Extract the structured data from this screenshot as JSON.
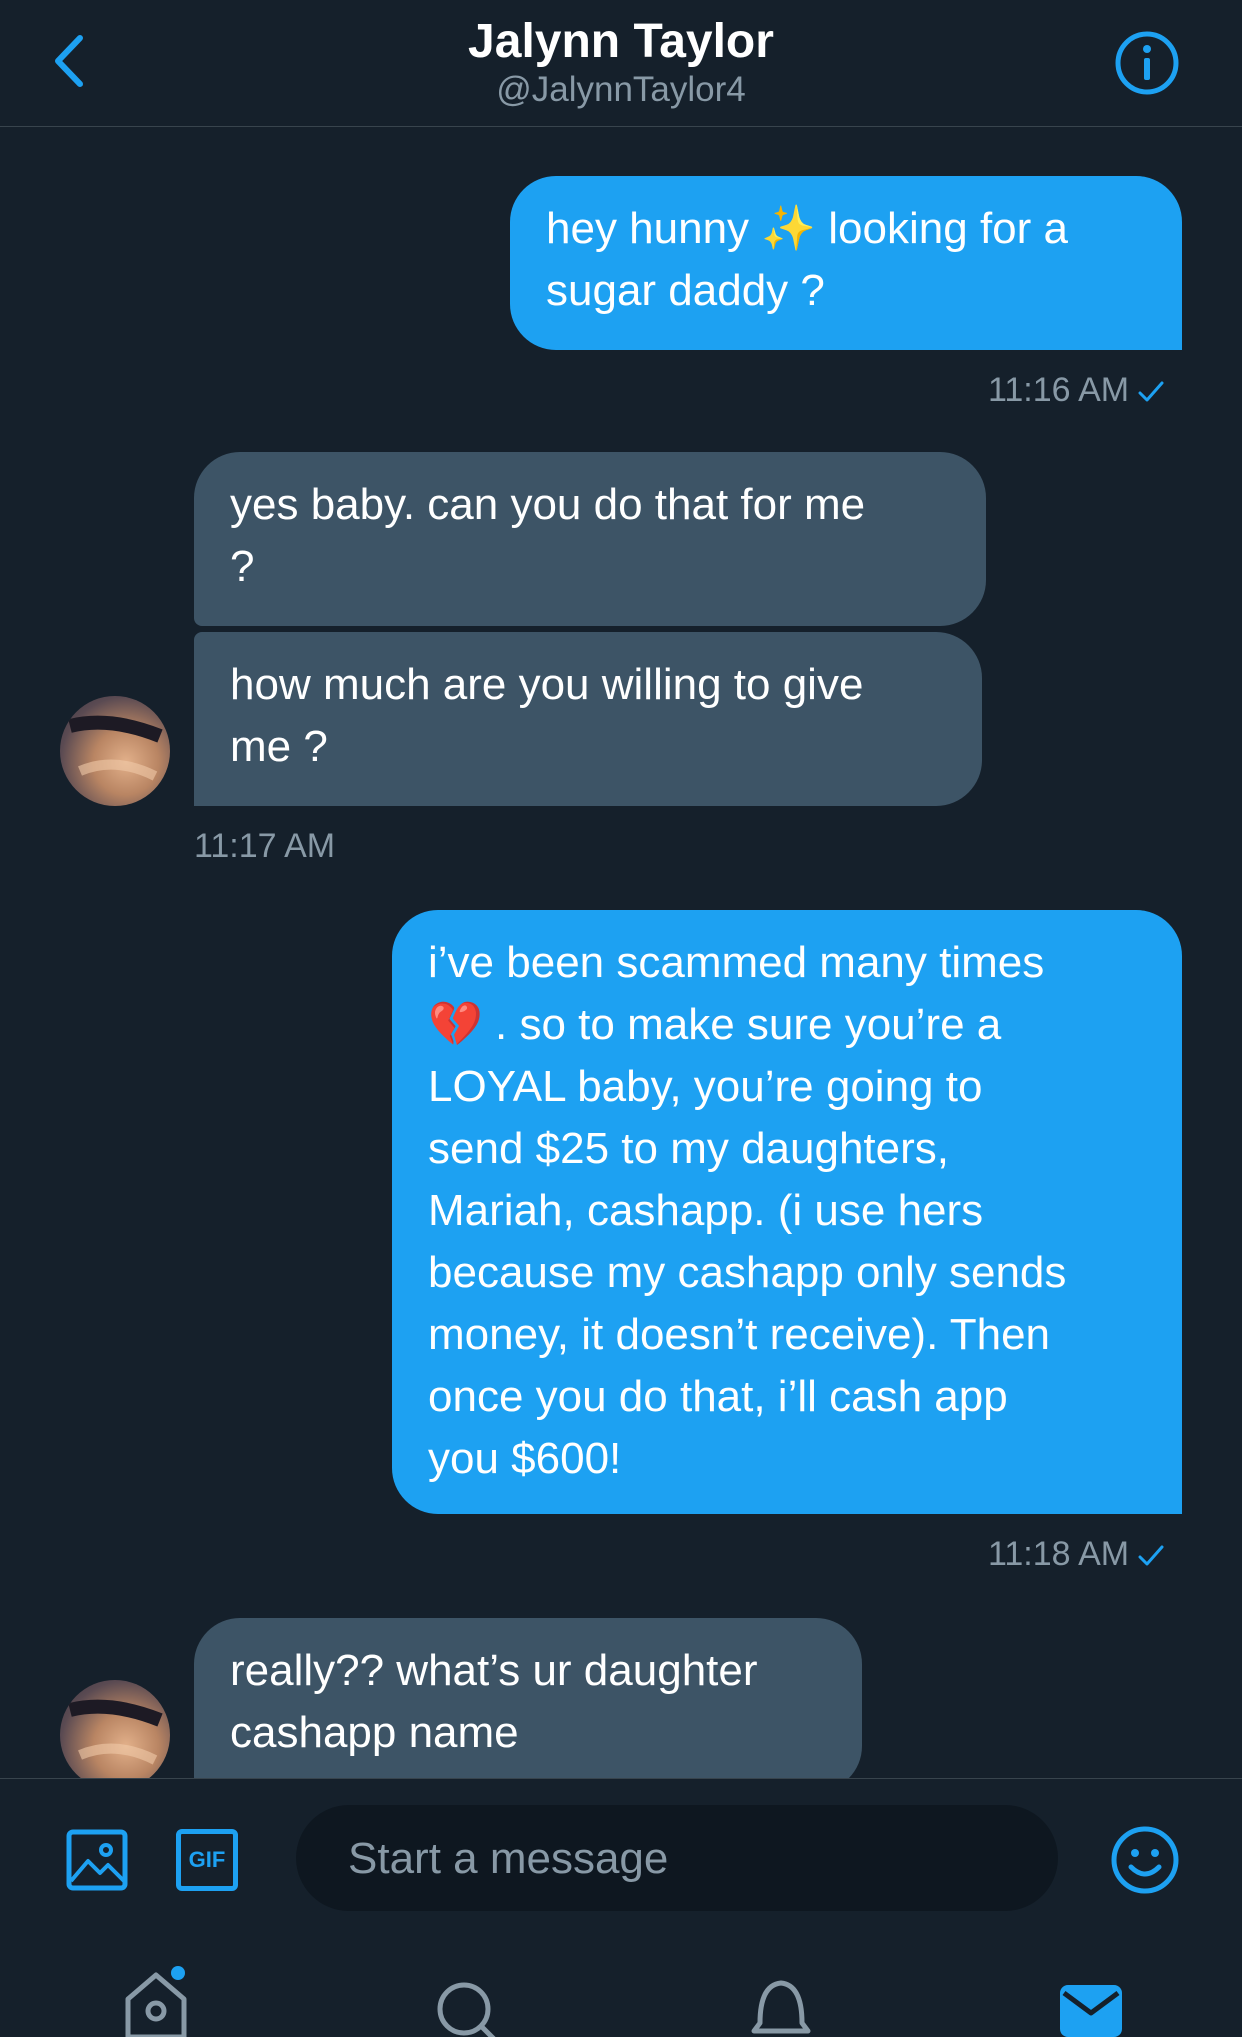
{
  "header": {
    "name": "Jalynn Taylor",
    "handle": "@JalynnTaylor4"
  },
  "messages": [
    {
      "direction": "sent",
      "lines": [
        "hey hunny ✨ looking for a",
        "sugar daddy ?"
      ],
      "time": "11:16 AM"
    },
    {
      "direction": "received",
      "lines": [
        "yes baby. can you do that for me",
        "?"
      ]
    },
    {
      "direction": "received",
      "lines": [
        "how much are you willing to give",
        "me ?"
      ],
      "time": "11:17 AM"
    },
    {
      "direction": "sent",
      "lines": [
        "i’ve been scammed many times",
        "💔 . so to make sure you’re a",
        "LOYAL baby, you’re going to",
        "send $25 to my daughters,",
        "Mariah, cashapp. (i use hers",
        "because my cashapp only sends",
        "money, it doesn’t receive). Then",
        "once you do that, i’ll cash app",
        "you $600!"
      ],
      "time": "11:18 AM"
    },
    {
      "direction": "received",
      "lines": [
        "really?? what’s ur daughter",
        "cashapp name"
      ]
    }
  ],
  "composer": {
    "placeholder": "Start a message",
    "gif_label": "GIF"
  },
  "colors": {
    "background": "#15202b",
    "accent": "#1da1f2",
    "received_bubble": "#3d5466",
    "secondary_text": "#8899a6"
  },
  "icons": [
    "back-chevron-icon",
    "info-icon",
    "image-icon",
    "gif-icon",
    "emoji-icon",
    "home-icon",
    "search-icon",
    "notifications-icon",
    "messages-icon"
  ]
}
